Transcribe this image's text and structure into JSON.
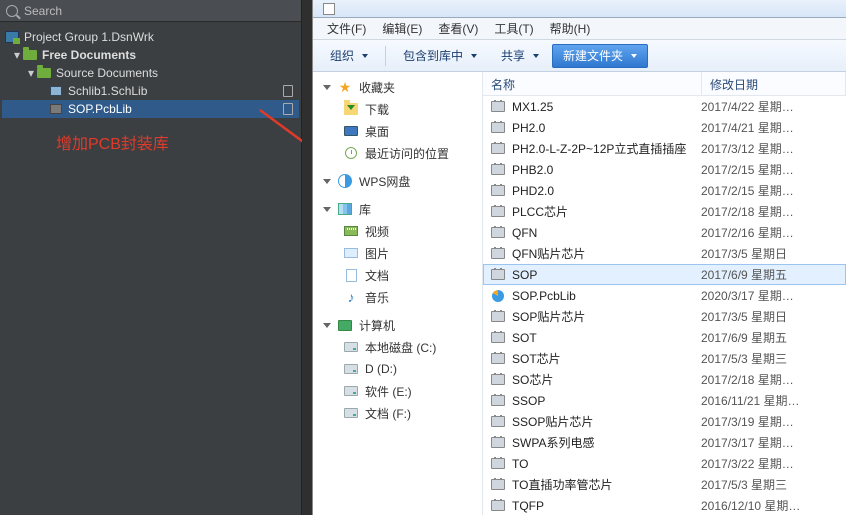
{
  "left": {
    "search": "Search",
    "project_group": "Project Group 1.DsnWrk",
    "free_docs": "Free Documents",
    "source_docs": "Source Documents",
    "schlib": "Schlib1.SchLib",
    "pcblib": "SOP.PcbLib",
    "annotation": "增加PCB封装库"
  },
  "menus": {
    "file": "文件(F)",
    "edit": "编辑(E)",
    "view": "查看(V)",
    "tools": "工具(T)",
    "help": "帮助(H)"
  },
  "toolbar": {
    "organize": "组织",
    "include": "包含到库中",
    "share": "共享",
    "newfolder": "新建文件夹"
  },
  "nav": {
    "fav": "收藏夹",
    "downloads": "下载",
    "desktop": "桌面",
    "recent": "最近访问的位置",
    "wps": "WPS网盘",
    "lib": "库",
    "videos": "视频",
    "pictures": "图片",
    "documents": "文档",
    "music": "音乐",
    "computer": "计算机",
    "c": "本地磁盘 (C:)",
    "d": "D (D:)",
    "e": "软件 (E:)",
    "f": "文档 (F:)"
  },
  "columns": {
    "name": "名称",
    "date": "修改日期"
  },
  "files": [
    {
      "name": "MX1.25",
      "date": "2017/4/22 星期…",
      "icon": "chip"
    },
    {
      "name": "PH2.0",
      "date": "2017/4/21 星期…",
      "icon": "chip"
    },
    {
      "name": "PH2.0-L-Z-2P~12P立式直插插座",
      "date": "2017/3/12 星期…",
      "icon": "chip"
    },
    {
      "name": "PHB2.0",
      "date": "2017/2/15 星期…",
      "icon": "chip"
    },
    {
      "name": "PHD2.0",
      "date": "2017/2/15 星期…",
      "icon": "chip"
    },
    {
      "name": "PLCC芯片",
      "date": "2017/2/18 星期…",
      "icon": "chip"
    },
    {
      "name": "QFN",
      "date": "2017/2/16 星期…",
      "icon": "chip"
    },
    {
      "name": "QFN贴片芯片",
      "date": "2017/3/5 星期日",
      "icon": "chip"
    },
    {
      "name": "SOP",
      "date": "2017/6/9 星期五",
      "icon": "chip",
      "sel": true
    },
    {
      "name": "SOP.PcbLib",
      "date": "2020/3/17 星期…",
      "icon": "ie"
    },
    {
      "name": "SOP贴片芯片",
      "date": "2017/3/5 星期日",
      "icon": "chip"
    },
    {
      "name": "SOT",
      "date": "2017/6/9 星期五",
      "icon": "chip"
    },
    {
      "name": "SOT芯片",
      "date": "2017/5/3 星期三",
      "icon": "chip"
    },
    {
      "name": "SO芯片",
      "date": "2017/2/18 星期…",
      "icon": "chip"
    },
    {
      "name": "SSOP",
      "date": "2016/11/21 星期…",
      "icon": "chip"
    },
    {
      "name": "SSOP贴片芯片",
      "date": "2017/3/19 星期…",
      "icon": "chip"
    },
    {
      "name": "SWPA系列电感",
      "date": "2017/3/17 星期…",
      "icon": "chip"
    },
    {
      "name": "TO",
      "date": "2017/3/22 星期…",
      "icon": "chip"
    },
    {
      "name": "TO直插功率管芯片",
      "date": "2017/5/3 星期三",
      "icon": "chip"
    },
    {
      "name": "TQFP",
      "date": "2016/12/10 星期…",
      "icon": "chip"
    }
  ]
}
